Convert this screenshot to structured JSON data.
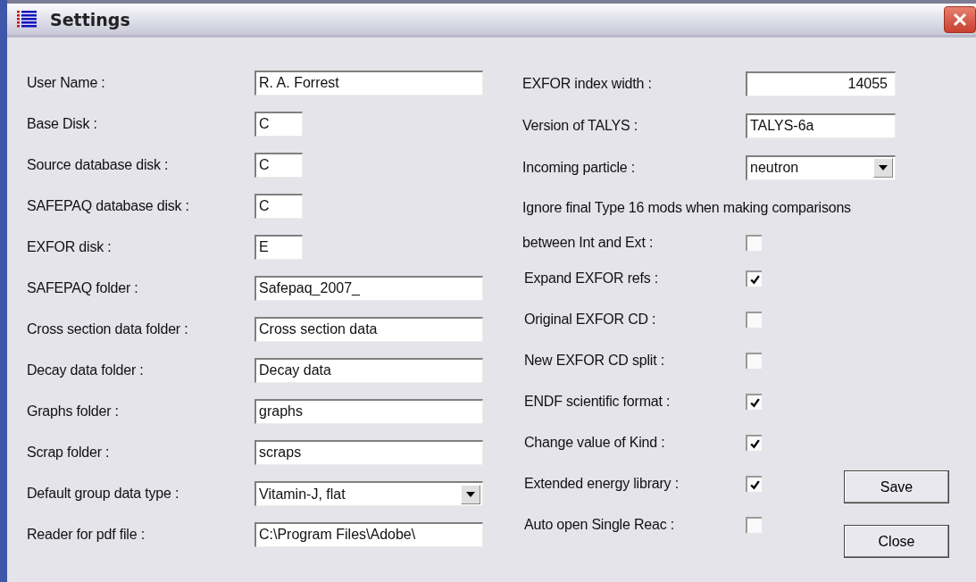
{
  "window": {
    "title": "Settings"
  },
  "left_fields": [
    {
      "label": "User Name :",
      "value": "R. A. Forrest",
      "kind": "text"
    },
    {
      "label": "Base Disk :",
      "value": "C",
      "kind": "short"
    },
    {
      "label": "Source database disk :",
      "value": "C",
      "kind": "short"
    },
    {
      "label": "SAFEPAQ database disk :",
      "value": "C",
      "kind": "short"
    },
    {
      "label": "EXFOR disk :",
      "value": "E",
      "kind": "short"
    },
    {
      "label": "SAFEPAQ folder :",
      "value": "Safepaq_2007_",
      "kind": "text"
    },
    {
      "label": "Cross section data folder :",
      "value": "Cross section data",
      "kind": "text"
    },
    {
      "label": "Decay data folder :",
      "value": "Decay data",
      "kind": "text"
    },
    {
      "label": "Graphs folder :",
      "value": "graphs",
      "kind": "text"
    },
    {
      "label": "Scrap folder :",
      "value": "scraps",
      "kind": "text"
    },
    {
      "label": "Default group data type :",
      "value": "Vitamin-J, flat",
      "kind": "select"
    },
    {
      "label": "Reader for pdf file :",
      "value": "C:\\Program Files\\Adobe\\",
      "kind": "text"
    }
  ],
  "right_fields": [
    {
      "label": "EXFOR index width :",
      "value": "14055",
      "kind": "number"
    },
    {
      "label": "Version of TALYS :",
      "value": "TALYS-6a",
      "kind": "text"
    },
    {
      "label": "Incoming particle :",
      "value": "neutron",
      "kind": "select"
    }
  ],
  "note": "Ignore final Type 16 mods when making comparisons",
  "checkboxes": [
    {
      "label": "between Int and Ext :",
      "checked": false
    },
    {
      "label": "Expand EXFOR refs :",
      "checked": true
    },
    {
      "label": "Original EXFOR CD :",
      "checked": false
    },
    {
      "label": "New EXFOR CD split :",
      "checked": false
    },
    {
      "label": "ENDF scientific format :",
      "checked": true
    },
    {
      "label": "Change value of Kind  :",
      "checked": true
    },
    {
      "label": "Extended energy library  :",
      "checked": true
    },
    {
      "label": "Auto open Single Reac :",
      "checked": false
    }
  ],
  "buttons": [
    "Save",
    "Close"
  ]
}
